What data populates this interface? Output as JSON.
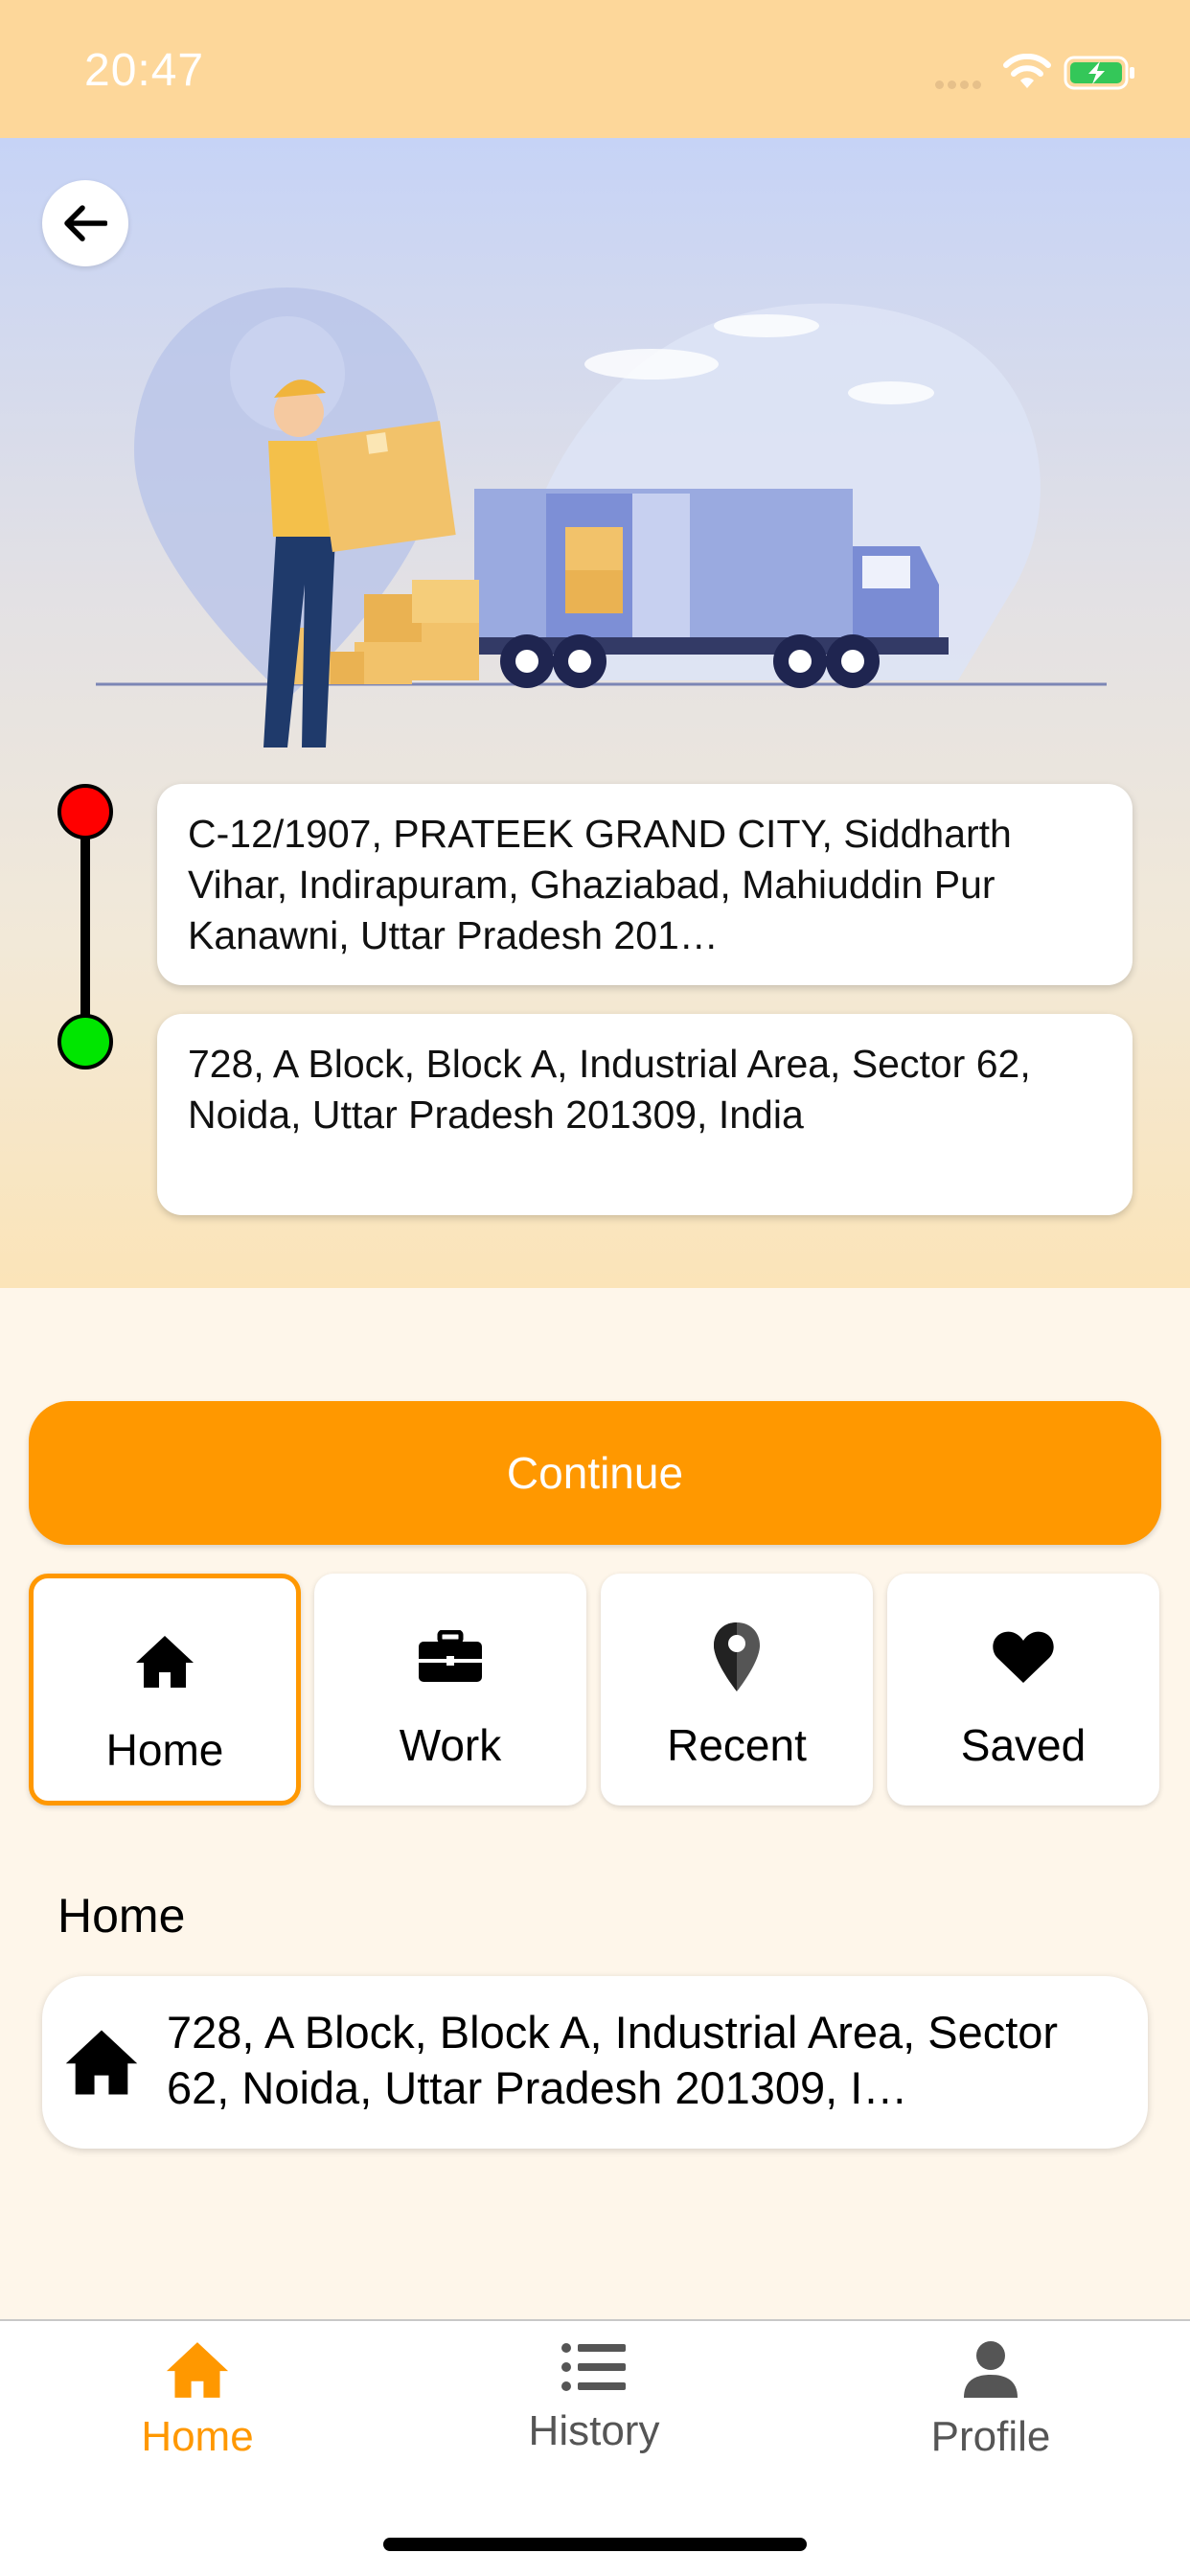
{
  "status_bar": {
    "time": "20:47",
    "icons": [
      "signal-dots-icon",
      "wifi-icon",
      "battery-charging-icon"
    ]
  },
  "header": {
    "back_icon": "arrow-left-icon"
  },
  "route": {
    "pickup_address": "C-12/1907, PRATEEK GRAND CITY, Siddharth Vihar, Indirapuram, Ghaziabad, Mahiuddin Pur Kanawni, Uttar Pradesh 201…",
    "drop_address": "728, A Block, Block A, Industrial Area, Sector 62, Noida, Uttar Pradesh 201309, India",
    "pickup_color": "#ff0000",
    "drop_color": "#00e600"
  },
  "actions": {
    "continue_label": "Continue",
    "accent_color": "#ff9800"
  },
  "categories": [
    {
      "label": "Home",
      "icon": "home-icon",
      "selected": true
    },
    {
      "label": "Work",
      "icon": "briefcase-icon",
      "selected": false
    },
    {
      "label": "Recent",
      "icon": "location-pin-icon",
      "selected": false
    },
    {
      "label": "Saved",
      "icon": "heart-icon",
      "selected": false
    }
  ],
  "section": {
    "title": "Home",
    "items": [
      {
        "icon": "home-icon",
        "address": "728, A Block, Block A, Industrial Area, Sector 62, Noida, Uttar Pradesh 201309, I…"
      }
    ]
  },
  "bottom_nav": [
    {
      "label": "Home",
      "icon": "home-icon",
      "active": true
    },
    {
      "label": "History",
      "icon": "list-icon",
      "active": false
    },
    {
      "label": "Profile",
      "icon": "person-icon",
      "active": false
    }
  ]
}
